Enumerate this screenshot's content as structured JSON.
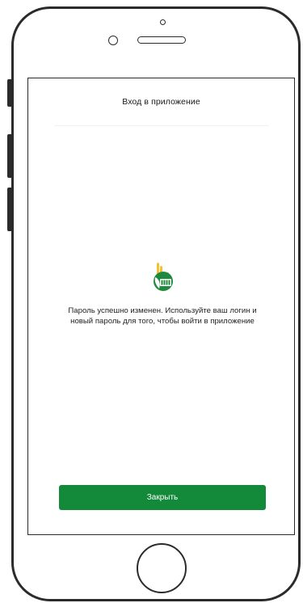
{
  "header": {
    "title": "Вход в приложение"
  },
  "main": {
    "message": "Пароль успешно изменен. Используйте ваш логин и новый пароль для того, чтобы войти в приложение",
    "logo_icon": "rshb-logo-icon",
    "close_label": "Закрыть"
  },
  "colors": {
    "accent": "#128a3a",
    "logo_gold": "#f2c230",
    "logo_green": "#1f8a3f"
  }
}
